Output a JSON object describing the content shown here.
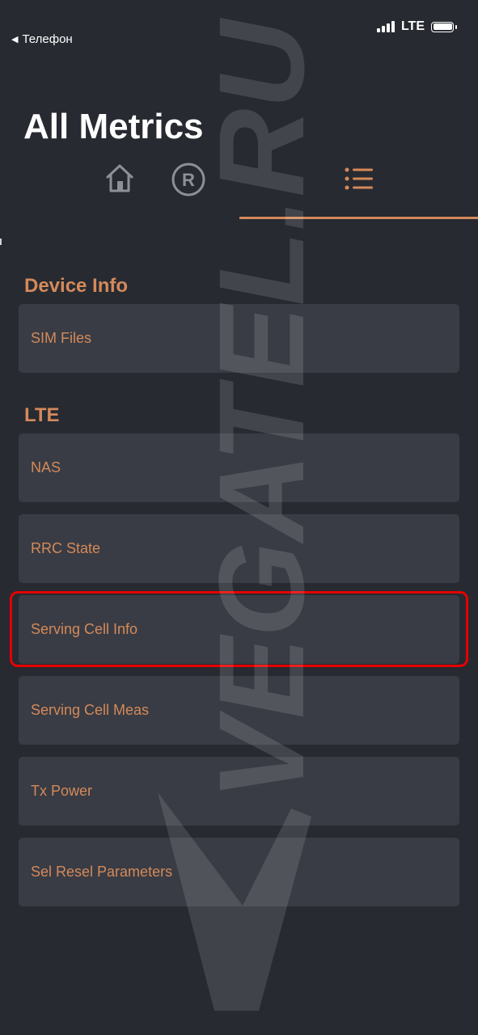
{
  "status_bar": {
    "back_label": "Телефон",
    "network": "LTE",
    "signal_bars": 4,
    "battery_level": 1.0
  },
  "header": {
    "title": "All Metrics"
  },
  "tabs": [
    {
      "icon": "home-icon",
      "active": false
    },
    {
      "icon": "registered-icon",
      "active": false
    },
    {
      "icon": "list-icon",
      "active": true
    }
  ],
  "sections": [
    {
      "title": "Device Info",
      "items": [
        "SIM Files"
      ]
    },
    {
      "title": "LTE",
      "items": [
        "NAS",
        "RRC State",
        "Serving Cell Info",
        "Serving Cell Meas",
        "Tx Power",
        "Sel Resel Parameters"
      ]
    }
  ],
  "highlighted_item": "Serving Cell Info",
  "watermark": {
    "text": "VEGATEL.RU"
  },
  "colors": {
    "background": "#272a31",
    "card": "#393c44",
    "accent": "#d4895a",
    "highlight": "#e60000",
    "icon_inactive": "#8d9096"
  }
}
